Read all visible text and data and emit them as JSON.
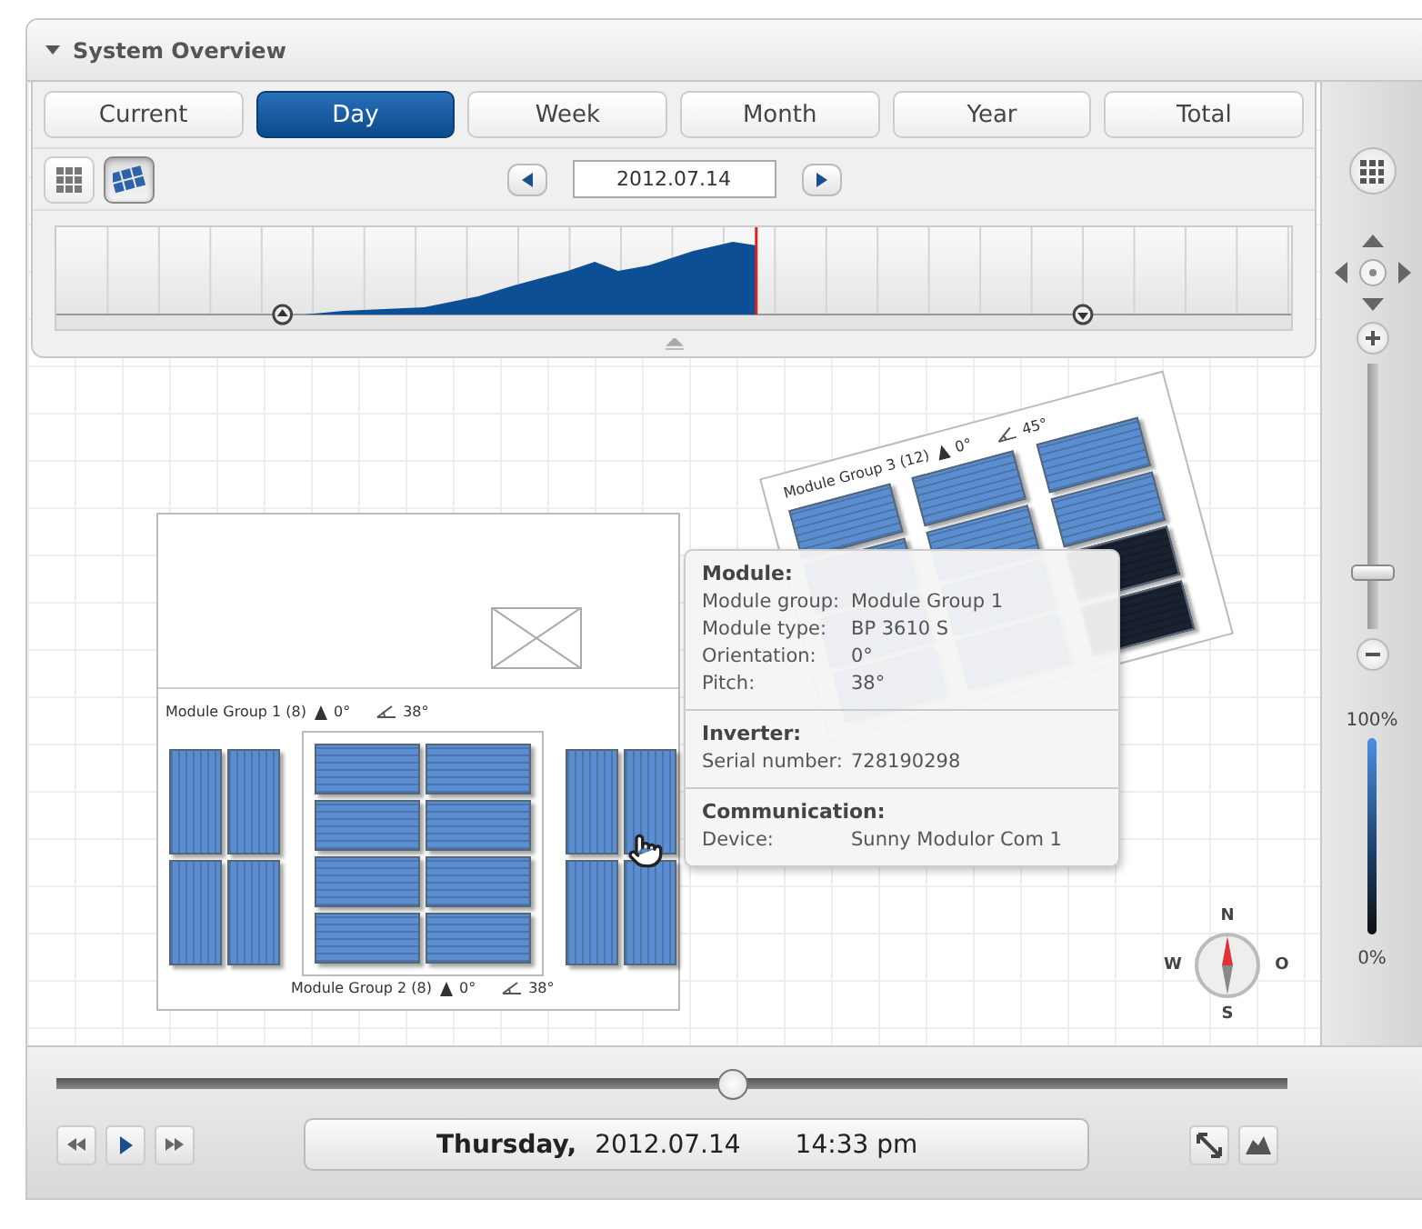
{
  "panel": {
    "title": "System Overview",
    "expanded": true
  },
  "tabs": [
    {
      "label": "Current",
      "selected": false
    },
    {
      "label": "Day",
      "selected": true
    },
    {
      "label": "Week",
      "selected": false
    },
    {
      "label": "Month",
      "selected": false
    },
    {
      "label": "Year",
      "selected": false
    },
    {
      "label": "Total",
      "selected": false
    }
  ],
  "view_buttons": [
    {
      "kind": "grid",
      "selected": false
    },
    {
      "kind": "layout",
      "selected": true
    }
  ],
  "date_field": {
    "value": "2012.07.14"
  },
  "module_groups": [
    {
      "label": "Module Group 1 (8)",
      "orientation": "0°",
      "pitch": "38°"
    },
    {
      "label": "Module Group 2 (8)",
      "orientation": "0°",
      "pitch": "38°"
    },
    {
      "label": "Module Group 3 (12)",
      "orientation": "0°",
      "pitch": "45°"
    }
  ],
  "tooltip": {
    "sections": [
      {
        "title": "Module:",
        "rows": [
          {
            "label": "Module group:",
            "value": "Module Group 1"
          },
          {
            "label": "Module type:",
            "value": "BP 3610 S"
          },
          {
            "label": "Orientation:",
            "value": "0°"
          },
          {
            "label": "Pitch:",
            "value": "38°"
          }
        ]
      },
      {
        "title": "Inverter:",
        "rows": [
          {
            "label": "Serial number:",
            "value": "728190298"
          }
        ]
      },
      {
        "title": "Communication:",
        "rows": [
          {
            "label": "Device:",
            "value": "Sunny Modulor Com 1"
          }
        ]
      }
    ]
  },
  "compass": {
    "north": "N",
    "west": "W",
    "east": "O",
    "south": "S"
  },
  "zoom": {
    "level": 0.2
  },
  "scale": {
    "max": "100%",
    "min": "0%"
  },
  "timeline": {
    "level": 0.55
  },
  "playback": {
    "day": "Thursday,",
    "date": "2012.07.14",
    "time": "14:33 pm"
  }
}
